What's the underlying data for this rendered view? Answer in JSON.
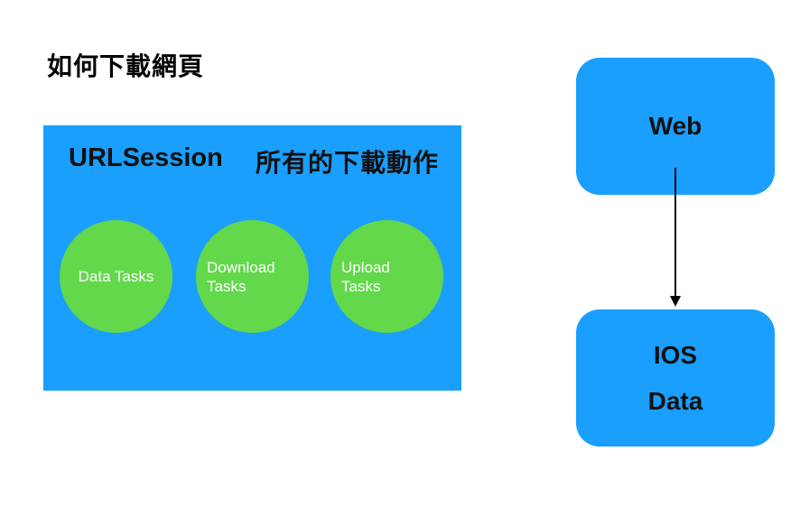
{
  "page": {
    "title": "如何下載網頁"
  },
  "session": {
    "label": "URLSession",
    "description": "所有的下載動作",
    "tasks": [
      {
        "label": "Data Tasks"
      },
      {
        "label": "Download\nTasks"
      },
      {
        "label": "Upload\nTasks"
      }
    ]
  },
  "flow": {
    "source": "Web",
    "target_line1": "IOS",
    "target_line2": "Data"
  },
  "colors": {
    "box_blue": "#1a9fff",
    "circle_green": "#62d84a",
    "text_dark": "#111111",
    "arrow": "#000000"
  }
}
